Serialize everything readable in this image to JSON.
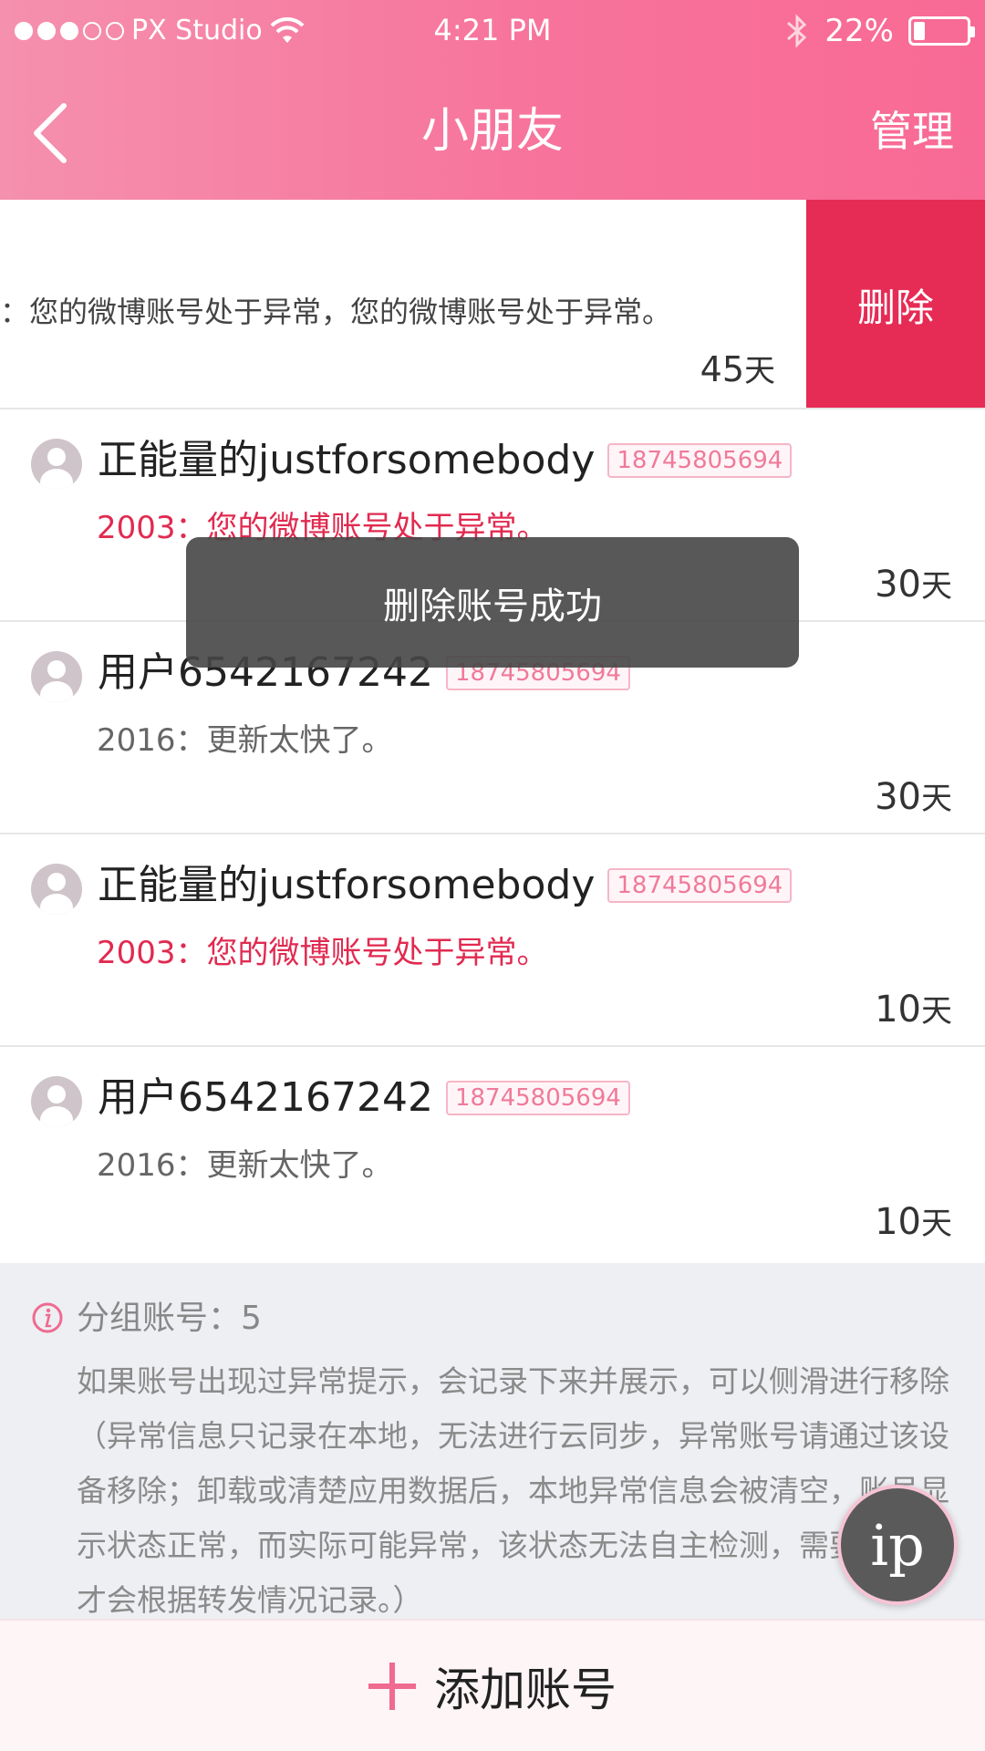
{
  "status_bar": {
    "carrier": "PX Studio",
    "time": "4:21 PM",
    "battery_percent": "22%",
    "battery_level": 0.22
  },
  "nav": {
    "title": "小朋友",
    "manage_label": "管理"
  },
  "swiped_row": {
    "message": "：您的微博账号处于异常，您的微博账号处于异常。",
    "days_value": "45",
    "days_unit": "天",
    "delete_label": "删除"
  },
  "accounts": [
    {
      "name": "正能量的justforsomebody",
      "phone": "18745805694",
      "message": "2003：您的微博账号处于异常。",
      "days_value": "30",
      "days_unit": "天"
    },
    {
      "name": "用户6542167242",
      "phone": "18745805694",
      "message": "2016：更新太快了。",
      "days_value": "30",
      "days_unit": "天"
    },
    {
      "name": "正能量的justforsomebody",
      "phone": "18745805694",
      "message": "2003：您的微博账号处于异常。",
      "days_value": "10",
      "days_unit": "天"
    },
    {
      "name": "用户6542167242",
      "phone": "18745805694",
      "message": "2016：更新太快了。",
      "days_value": "10",
      "days_unit": "天"
    }
  ],
  "info": {
    "count_label": "分组账号：5",
    "description": "如果账号出现过异常提示，会记录下来并展示，可以侧滑进行移除（异常信息只记录在本地，无法进行云同步，异常账号请通过该设备移除；卸载或清楚应用数据后，本地异常信息会被清空，账号显示状态正常，而实际可能异常，该状态无法自主检测，需要启动后才会根据转发情况记录。）"
  },
  "add_button_label": "添加账号",
  "toast": "删除账号成功",
  "floating_bubble_label": "ip",
  "colors": {
    "header_start": "#f590ae",
    "header_end": "#f86a95",
    "delete_red": "#e62b55",
    "error_red": "#e12a50",
    "accent_pink": "#ef6b90"
  }
}
